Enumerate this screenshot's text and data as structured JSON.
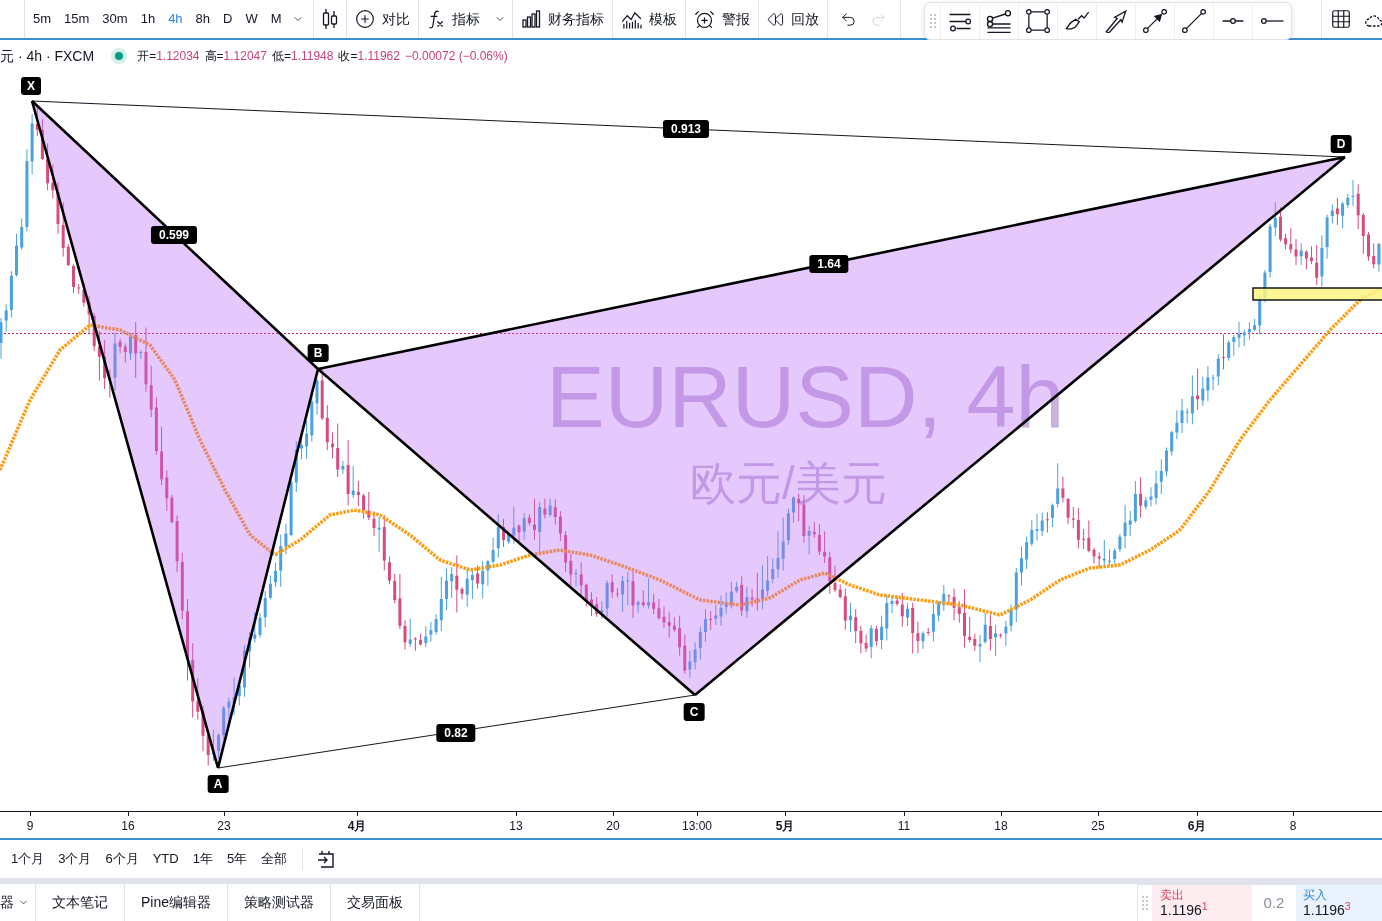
{
  "toolbar": {
    "intervals": [
      {
        "label": "5m",
        "selected": false
      },
      {
        "label": "15m",
        "selected": false
      },
      {
        "label": "30m",
        "selected": false
      },
      {
        "label": "1h",
        "selected": false
      },
      {
        "label": "4h",
        "selected": true
      },
      {
        "label": "8h",
        "selected": false
      },
      {
        "label": "D",
        "selected": false
      },
      {
        "label": "W",
        "selected": false
      },
      {
        "label": "M",
        "selected": false
      }
    ],
    "buttons": [
      {
        "kind": "compare",
        "label": "对比"
      },
      {
        "kind": "indicators",
        "label": "指标"
      },
      {
        "kind": "financials",
        "label": "财务指标"
      },
      {
        "kind": "templates",
        "label": "模板"
      },
      {
        "kind": "alert",
        "label": "警报"
      },
      {
        "kind": "replay",
        "label": "回放"
      }
    ],
    "history": [
      {
        "kind": "undo",
        "disabled": false
      },
      {
        "kind": "redo",
        "disabled": true
      }
    ]
  },
  "legend": {
    "symbol": "元 · 4h · FXCM",
    "ohlc": [
      {
        "label": "开=",
        "value": "1.12034"
      },
      {
        "label": "高=",
        "value": "1.12047"
      },
      {
        "label": "低=",
        "value": "1.11948"
      },
      {
        "label": "收=",
        "value": "1.11962"
      }
    ],
    "change": "−0.00072 (−0.06%)"
  },
  "watermark": {
    "symbol": "EURUSD, 4h",
    "description": "欧元/美元"
  },
  "pattern": {
    "points": [
      "X",
      "A",
      "B",
      "C",
      "D"
    ],
    "ratios": [
      "0.599",
      "0.913",
      "1.64",
      "0.82"
    ]
  },
  "time_axis": [
    {
      "label": "9",
      "kind": "day"
    },
    {
      "label": "16",
      "kind": "day"
    },
    {
      "label": "23",
      "kind": "day"
    },
    {
      "label": "4月",
      "kind": "month"
    },
    {
      "label": "13",
      "kind": "day"
    },
    {
      "label": "20",
      "kind": "day"
    },
    {
      "label": "13:00",
      "kind": "day"
    },
    {
      "label": "5月",
      "kind": "month"
    },
    {
      "label": "11",
      "kind": "day"
    },
    {
      "label": "18",
      "kind": "day"
    },
    {
      "label": "25",
      "kind": "day"
    },
    {
      "label": "6月",
      "kind": "month"
    },
    {
      "label": "8",
      "kind": "day"
    }
  ],
  "ranges": [
    "1个月",
    "3个月",
    "6个月",
    "YTD",
    "1年",
    "5年",
    "全部"
  ],
  "bottom_tabs": [
    {
      "label": "器",
      "menu": true
    },
    {
      "label": "文本笔记",
      "menu": false
    },
    {
      "label": "Pine编辑器",
      "menu": false
    },
    {
      "label": "策略测试器",
      "menu": false
    },
    {
      "label": "交易面板",
      "menu": false
    }
  ],
  "trade": {
    "sell": {
      "label": "卖出",
      "price": "1.1196$^{1}$"
    },
    "spread": "0.2",
    "buy": {
      "label": "买入",
      "price": "1.1196$^{3}$"
    }
  }
}
